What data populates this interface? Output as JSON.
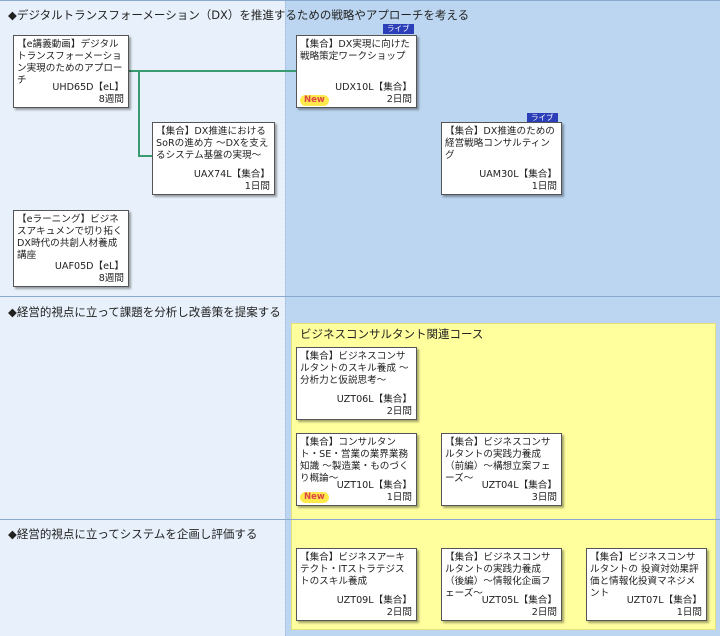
{
  "sections": [
    {
      "title": "◆デジタルトランスフォーメーション（DX）を推進するための戦略やアプローチを考える"
    },
    {
      "title": "◆経営的視点に立って課題を分析し改善策を提案する"
    },
    {
      "title": "◆経営的視点に立ってシステムを企画し評価する"
    }
  ],
  "group": {
    "title": "ビジネスコンサルタント関連コース"
  },
  "badges": {
    "live": "ライブ",
    "new": "New"
  },
  "courses": [
    {
      "title": "【e講義動画】デジタルトランスフォーメーション実現のためのアプローチ",
      "code": "UHD65D【eL】",
      "duration": "8週間"
    },
    {
      "title": "【集合】DX実現に向けた戦略策定ワークショップ",
      "code": "UDX10L【集合】",
      "duration": "2日間"
    },
    {
      "title": "【集合】DX推進における SoRの進め方 ～DXを支えるシステム基盤の実現～",
      "code": "UAX74L【集合】",
      "duration": "1日間"
    },
    {
      "title": "【集合】DX推進のための経営戦略コンサルティング",
      "code": "UAM30L【集合】",
      "duration": "1日間"
    },
    {
      "title": "【eラーニング】ビジネスアキュメンで切り拓くDX時代の共創人材養成講座",
      "code": "UAF05D【eL】",
      "duration": "8週間"
    },
    {
      "title": "【集合】ビジネスコンサルタントのスキル養成 ～分析力と仮説思考～",
      "code": "UZT06L【集合】",
      "duration": "2日間"
    },
    {
      "title": "【集合】コンサルタント・SE・営業の業界業務知識 ～製造業・ものづくり概論～",
      "code": "UZT10L【集合】",
      "duration": "1日間"
    },
    {
      "title": "【集合】ビジネスコンサルタントの実践力養成（前編）～構想立案フェーズ～",
      "code": "UZT04L【集合】",
      "duration": "3日間"
    },
    {
      "title": "【集合】ビジネスアーキテクト・ITストラテジストのスキル養成",
      "code": "UZT09L【集合】",
      "duration": "2日間"
    },
    {
      "title": "【集合】ビジネスコンサルタントの実践力養成（後編）～情報化企画フェーズ～",
      "code": "UZT05L【集合】",
      "duration": "2日間"
    },
    {
      "title": "【集合】ビジネスコンサルタントの 投資対効果評価と情報化投資マネジメント",
      "code": "UZT07L【集合】",
      "duration": "1日間"
    }
  ]
}
